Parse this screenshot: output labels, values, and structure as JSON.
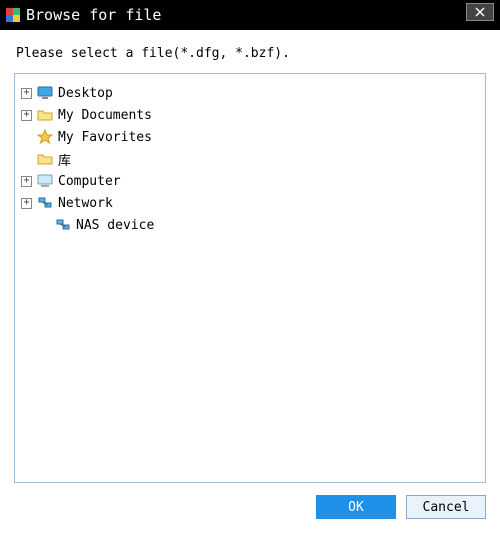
{
  "window": {
    "title": "Browse for file"
  },
  "prompt": "Please select a file(*.dfg, *.bzf).",
  "tree": {
    "items": [
      {
        "label": "Desktop",
        "icon": "desktop",
        "expandable": true,
        "indent": 0
      },
      {
        "label": "My Documents",
        "icon": "folder",
        "expandable": true,
        "indent": 0
      },
      {
        "label": "My Favorites",
        "icon": "star",
        "expandable": false,
        "indent": 0
      },
      {
        "label": "库",
        "icon": "folder",
        "expandable": false,
        "indent": 0
      },
      {
        "label": "Computer",
        "icon": "computer",
        "expandable": true,
        "indent": 0
      },
      {
        "label": "Network",
        "icon": "network",
        "expandable": true,
        "indent": 0
      },
      {
        "label": "NAS device",
        "icon": "network",
        "expandable": false,
        "indent": 1
      }
    ]
  },
  "buttons": {
    "ok": "OK",
    "cancel": "Cancel"
  }
}
